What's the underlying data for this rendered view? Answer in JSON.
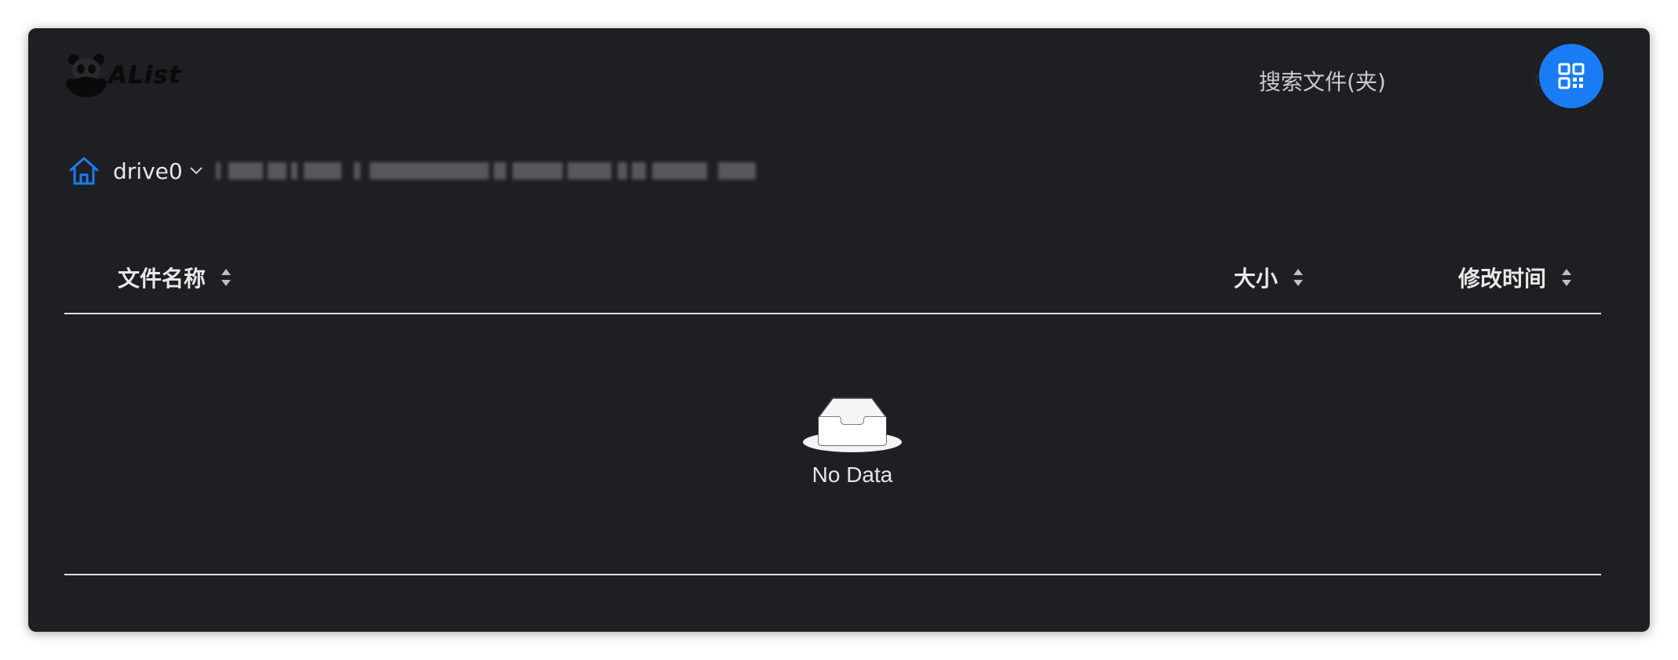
{
  "app": {
    "logo_text": "AList"
  },
  "header": {
    "search_placeholder": "搜索文件(夹)",
    "search_icon": "search-icon",
    "qr_icon": "qr-code-icon",
    "accent_color": "#1a7cf5"
  },
  "breadcrumb": {
    "home_icon": "home-icon",
    "drive": "drive0",
    "path_blurred": true
  },
  "table": {
    "columns": [
      {
        "label": "文件名称",
        "sortable": true
      },
      {
        "label": "大小",
        "sortable": true
      },
      {
        "label": "修改时间",
        "sortable": true
      }
    ],
    "rows": []
  },
  "empty_state": {
    "icon": "empty-inbox-icon",
    "text": "No Data"
  }
}
